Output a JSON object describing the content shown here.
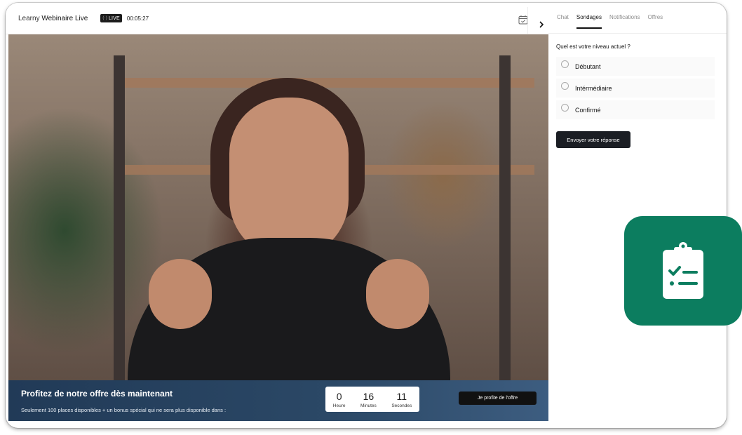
{
  "header": {
    "brand_prefix": "Learny",
    "brand_name": "Webinaire Live",
    "live_label": "LIVE",
    "live_dots": "(·)",
    "elapsed": "00:05:27",
    "calendar_icon": "calendar-check-icon",
    "collapse_icon": "chevron-right-icon"
  },
  "tabs": [
    {
      "label": "Chat",
      "active": false
    },
    {
      "label": "Sondages",
      "active": true
    },
    {
      "label": "Notifications",
      "active": false
    },
    {
      "label": "Offres",
      "active": false
    }
  ],
  "poll": {
    "question": "Quel est votre niveau actuel ?",
    "options": [
      "Débutant",
      "Intérmédiaire",
      "Confirmé"
    ],
    "submit_label": "Envoyer votre réponse"
  },
  "offer": {
    "title": "Profitez de notre offre dès maintenant",
    "subtitle": "Seulement 100 places disponibles + un bonus spécial qui ne sera plus disponible dans :",
    "countdown": {
      "hours_value": "0",
      "hours_label": "Heure",
      "minutes_value": "16",
      "minutes_label": "Minutes",
      "seconds_value": "11",
      "seconds_label": "Secondes"
    },
    "button_label": "Je profite de l'offre"
  },
  "colors": {
    "accent_green": "#0c7d5f",
    "banner_blue": "#213a57",
    "button_dark": "#1b1e24"
  },
  "floating_icon": "clipboard-checklist-icon"
}
